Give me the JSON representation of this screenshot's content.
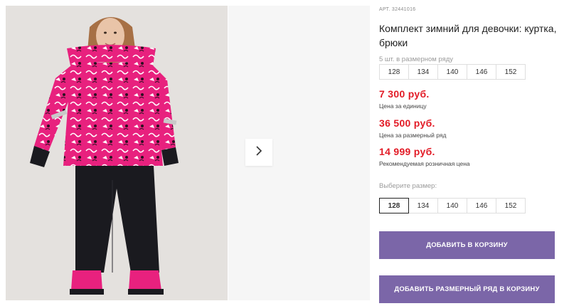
{
  "product": {
    "article": "АРТ. 32441016",
    "title": "Комплект зимний для девочки: куртка, брюки"
  },
  "size_range": {
    "hint": "5 шт. в размерном ряду",
    "sizes": [
      "128",
      "134",
      "140",
      "146",
      "152"
    ]
  },
  "prices": {
    "unit_price": "7 300 руб.",
    "unit_label": "Цена за единицу",
    "range_price": "36 500 руб.",
    "range_label": "Цена за размерный ряд",
    "retail_price": "14 999 руб.",
    "retail_label": "Рекомендуемая розничная цена"
  },
  "size_select": {
    "hint": "Выберите размер:",
    "sizes": [
      "128",
      "134",
      "140",
      "146",
      "152"
    ],
    "selected": "128"
  },
  "actions": {
    "add_to_cart": "ДОБАВИТЬ В КОРЗИНУ",
    "add_range_to_cart": "ДОБАВИТЬ РАЗМЕРНЫЙ РЯД В КОРЗИНУ"
  },
  "colors": {
    "price": "#e21b26",
    "button": "#7b66a8",
    "jacket": "#e8217e",
    "pants": "#1a1a1f"
  },
  "icons": {
    "next": "chevron-right-icon"
  }
}
